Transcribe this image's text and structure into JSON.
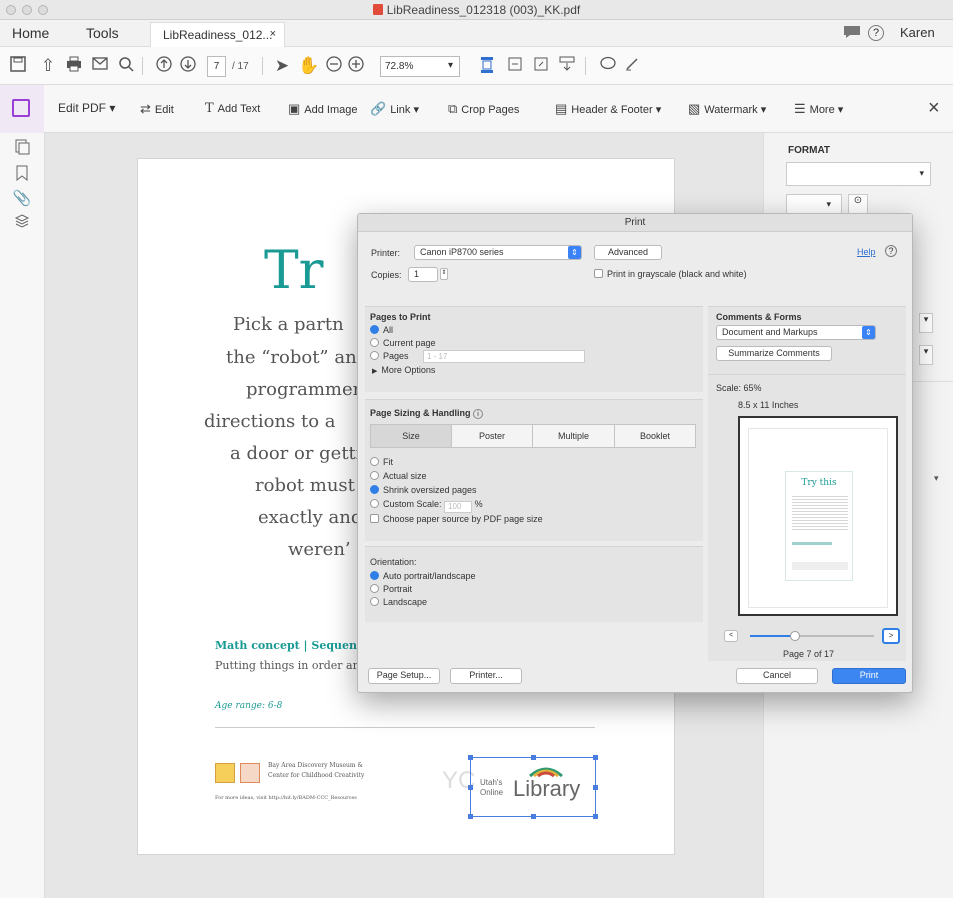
{
  "window": {
    "title": "LibReadiness_012318 (003)_KK.pdf"
  },
  "tabs": {
    "home": "Home",
    "tools": "Tools",
    "document": "LibReadiness_012...",
    "close": "×"
  },
  "user": {
    "name": "Karen"
  },
  "toolbar": {
    "page_current": "7",
    "page_total": "/ 17",
    "zoom": "72.8%"
  },
  "edit_toolbar": {
    "edit_pdf": "Edit PDF",
    "edit": "Edit",
    "add_text": "Add Text",
    "add_image": "Add Image",
    "link": "Link",
    "crop_pages": "Crop Pages",
    "header_footer": "Header & Footer",
    "watermark": "Watermark",
    "more": "More",
    "close": "×"
  },
  "right_pane": {
    "format_label": "FORMAT"
  },
  "document": {
    "heading": "Tr",
    "lines": [
      "Pick a partn",
      "the “robot” an",
      "programmer",
      "directions to a",
      "a door or getti",
      "robot must",
      "exactly and",
      "weren’"
    ],
    "math_concept": "Math concept | Sequenc",
    "math_desc": "Putting things in order ar",
    "age_range": "Age range: 6-8",
    "sponsor_line1": "Bay Area Discovery Museum &",
    "sponsor_line2": "Center for Childhood Creativity",
    "sponsor_url": "For more ideas, visit http://bit.ly/BADM-CCC_Resources",
    "library_small1": "Utah's",
    "library_small2": "Online",
    "library_big": "Library",
    "faint_yc": "YC"
  },
  "print_dialog": {
    "title": "Print",
    "printer_label": "Printer:",
    "printer_value": "Canon iP8700 series",
    "advanced": "Advanced",
    "help": "Help",
    "copies_label": "Copies:",
    "copies_value": "1",
    "grayscale": "Print in grayscale (black and white)",
    "pages_to_print": "Pages to Print",
    "all": "All",
    "current_page": "Current page",
    "pages": "Pages",
    "pages_range": "1 - 17",
    "more_options": "More Options",
    "comments_forms": "Comments & Forms",
    "comments_value": "Document and Markups",
    "summarize": "Summarize Comments",
    "scale": "Scale: 65%",
    "paper_size": "8.5 x 11 Inches",
    "page_sizing": "Page Sizing & Handling",
    "seg": [
      "Size",
      "Poster",
      "Multiple",
      "Booklet"
    ],
    "fit": "Fit",
    "actual_size": "Actual size",
    "shrink": "Shrink oversized pages",
    "custom_scale": "Custom Scale:",
    "custom_value": "100",
    "percent": "%",
    "paper_source": "Choose paper source by PDF page size",
    "orientation": "Orientation:",
    "auto": "Auto portrait/landscape",
    "portrait": "Portrait",
    "landscape": "Landscape",
    "page_of": "Page 7 of 17",
    "page_setup": "Page Setup...",
    "printer_btn": "Printer...",
    "cancel": "Cancel",
    "print": "Print",
    "preview_title": "Try this"
  }
}
